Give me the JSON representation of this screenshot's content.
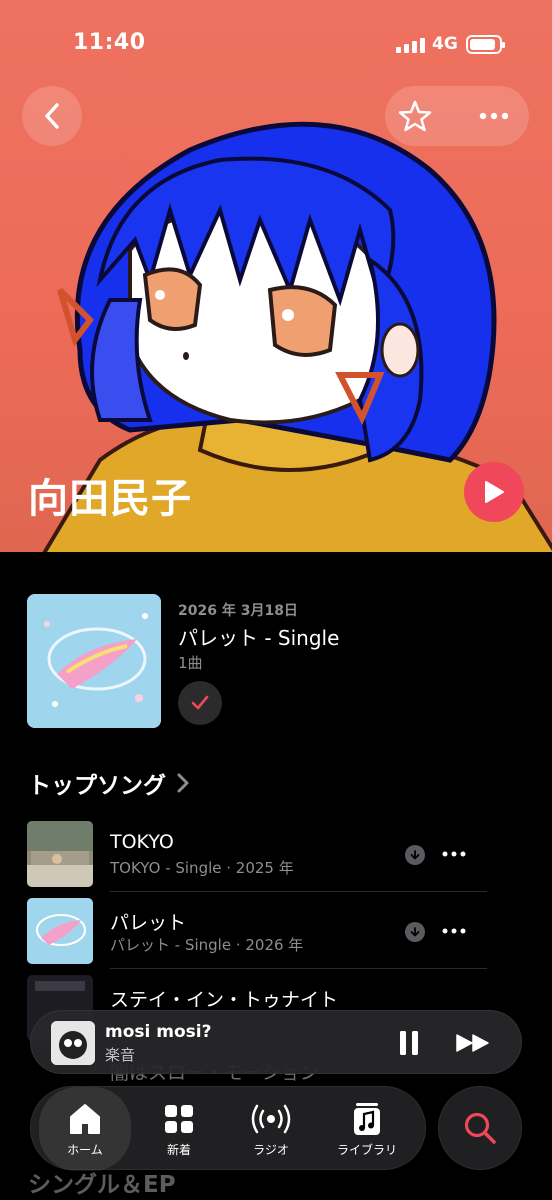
{
  "status_bar": {
    "time": "11:40",
    "network": "4G"
  },
  "hero": {
    "artist_name": "向田民子"
  },
  "latest_release": {
    "date": "2026 年 3月18日",
    "title": "パレット - Single",
    "track_count": "1曲"
  },
  "top_songs": {
    "heading": "トップソング",
    "items": [
      {
        "title": "TOKYO",
        "subtitle": "TOKYO - Single · 2025 年"
      },
      {
        "title": "パレット",
        "subtitle": "パレット - Single · 2026 年"
      },
      {
        "title": "ステイ・イン・トゥナイト",
        "subtitle": ""
      }
    ],
    "partially_hidden": "闇はスロー・モーション"
  },
  "next_section_heading": "シングル＆EP",
  "now_playing": {
    "title": "mosi mosi?",
    "artist": "楽音"
  },
  "tab_bar": {
    "tabs": [
      {
        "label": "ホーム",
        "icon": "home-icon",
        "active": true
      },
      {
        "label": "新着",
        "icon": "grid-icon"
      },
      {
        "label": "ラジオ",
        "icon": "radio-icon"
      },
      {
        "label": "ライブラリ",
        "icon": "library-icon"
      }
    ],
    "search_icon": "search-icon"
  },
  "colors": {
    "accent": "#f0485a",
    "hero_bg": "#ec6b58",
    "hair_blue": "#1730ee"
  }
}
